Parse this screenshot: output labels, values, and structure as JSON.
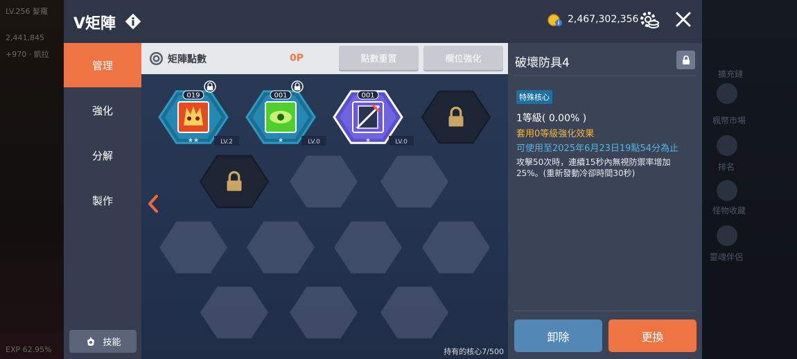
{
  "window": {
    "title": "V矩陣"
  },
  "header": {
    "meso": "2,467,302,356"
  },
  "tabs": [
    {
      "label": "管理",
      "active": true
    },
    {
      "label": "強化",
      "active": false
    },
    {
      "label": "分解",
      "active": false
    },
    {
      "label": "製作",
      "active": false
    }
  ],
  "skill_button": {
    "label": "技能"
  },
  "points_bar": {
    "label": "矩陣點數",
    "value": "0P",
    "reset_button": "點數重置",
    "slot_button": "欄位強化"
  },
  "slots": [
    {
      "number": "019",
      "level": "LV.2",
      "stars": "★★",
      "locked_badge": true,
      "color": "#e84a1f",
      "state": "core",
      "icon": "flame-face-icon"
    },
    {
      "number": "001",
      "level": "LV.0",
      "stars": "★",
      "locked_badge": true,
      "color": "#4fcf2c",
      "state": "core",
      "icon": "eye-glyph-icon"
    },
    {
      "number": "001",
      "level": "LV.0",
      "stars": "★",
      "locked_badge": false,
      "color": "#6a58d8",
      "state": "selected",
      "icon": "armor-break-icon"
    },
    {
      "state": "locked"
    },
    {
      "state": "locked"
    },
    {
      "state": "empty"
    },
    {
      "state": "empty"
    },
    {
      "state": "empty"
    },
    {
      "state": "empty"
    },
    {
      "state": "empty"
    },
    {
      "state": "empty"
    },
    {
      "state": "empty"
    },
    {
      "state": "empty"
    },
    {
      "state": "empty"
    }
  ],
  "core_count": "持有的核心7/500",
  "detail": {
    "title": "破壞防具4",
    "badge": "特殊核心",
    "level": "1等級( 0.00% )",
    "effect": "套用0等級強化效果",
    "expire": "可使用至2025年6月23日19點54分為止",
    "description": "攻擊50次時，連續15秒內無視防禦率增加25%。(重新發動冷卻時間30秒)",
    "remove_button": "卸除",
    "replace_button": "更換"
  },
  "background": {
    "left_texts": [
      "LV.256 髮羅",
      "2,441,845",
      "+970 · 凱拉"
    ],
    "right_texts": [
      "擴充鏈",
      "楓幣市場",
      "排名",
      "怪物收藏",
      "靈魂伴侶"
    ],
    "exp": "EXP 62.95%"
  },
  "colors": {
    "accent": "#ee7444",
    "remove": "#5387b5",
    "expire": "#52b6e6",
    "effect": "#f5b63b"
  }
}
